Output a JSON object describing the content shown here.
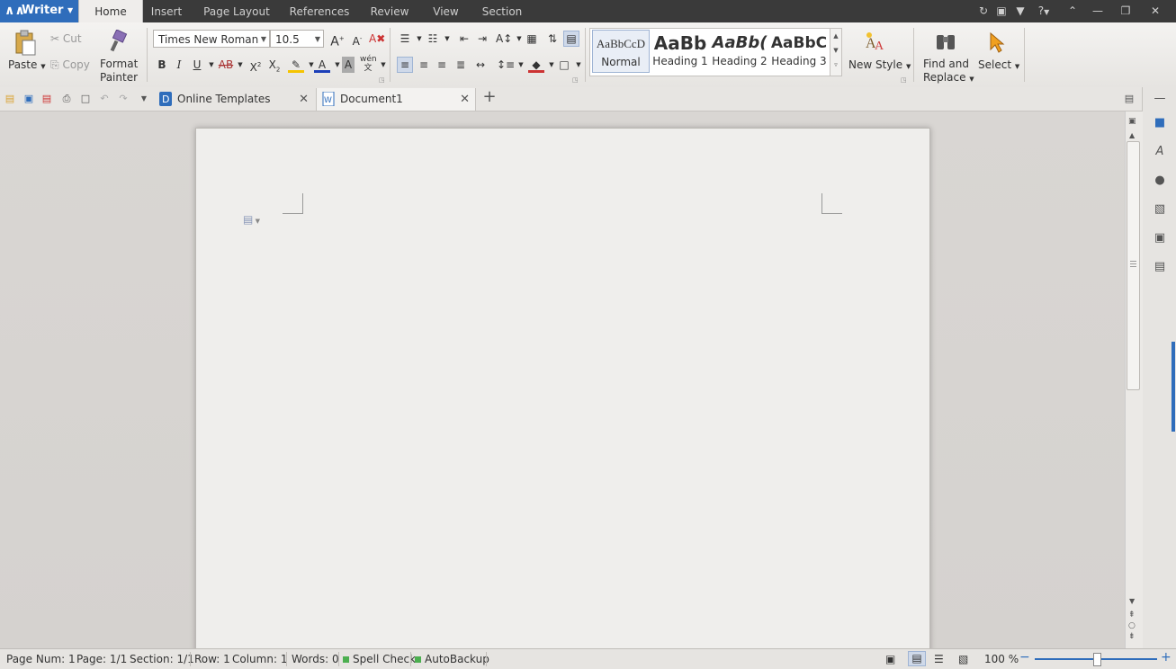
{
  "titlebar": {
    "app_name": "Writer",
    "menu_tabs": [
      "Home",
      "Insert",
      "Page Layout",
      "References",
      "Review",
      "View",
      "Section"
    ],
    "help": "?"
  },
  "ribbon": {
    "paste": "Paste",
    "cut": "Cut",
    "copy": "Copy",
    "format_painter_line1": "Format",
    "format_painter_line2": "Painter",
    "font_name": "Times New Roman",
    "font_size": "10.5",
    "styles": [
      {
        "preview": "AaBbCcD",
        "label": "Normal"
      },
      {
        "preview": "AaBb",
        "label": "Heading 1"
      },
      {
        "preview": "AaBb(",
        "label": "Heading 2"
      },
      {
        "preview": "AaBbC",
        "label": "Heading 3"
      }
    ],
    "new_style": "New Style",
    "find_replace_line1": "Find and",
    "find_replace_line2": "Replace",
    "select": "Select"
  },
  "tabs": {
    "items": [
      {
        "label": "Online Templates",
        "active": false
      },
      {
        "label": "Document1",
        "active": true
      }
    ]
  },
  "status": {
    "page_num": "Page Num: 1",
    "page": "Page: 1/1",
    "section": "Section: 1/1",
    "row": "Row: 1",
    "column": "Column: 1",
    "words": "Words: 0",
    "spell_check": "Spell Check",
    "autobackup": "AutoBackup",
    "zoom_label": "100 %",
    "zoom_value": 100
  },
  "colors": {
    "accent": "#2f6dbb",
    "titlebar": "#3a3a3a",
    "status_dot": "#4caf50",
    "highlight": "#f5c400",
    "font_color": "#1c3fb8"
  }
}
